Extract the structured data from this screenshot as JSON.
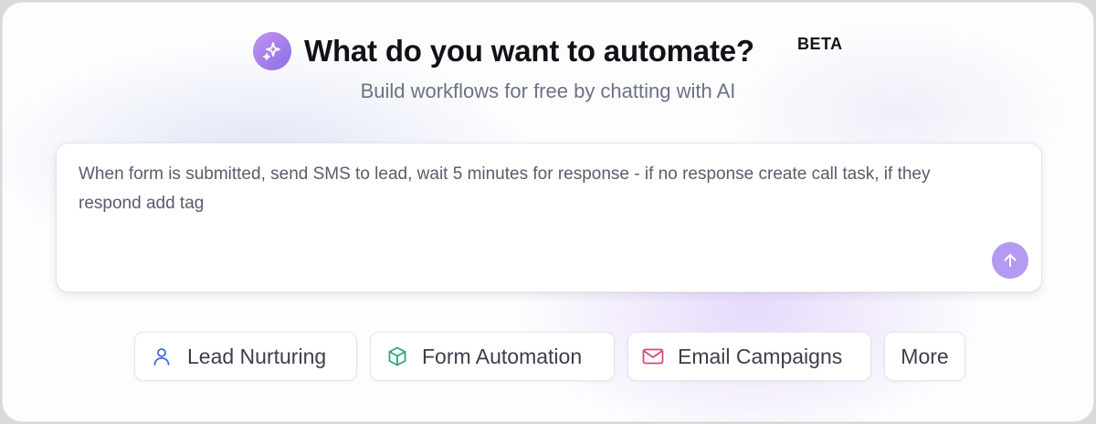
{
  "header": {
    "title": "What do you want to automate?",
    "badge": "BETA",
    "subtitle": "Build workflows for free by chatting with AI",
    "icon": "sparkle-icon"
  },
  "prompt": {
    "value": "When form is submitted, send SMS to lead, wait 5 minutes for response - if no response create call task, if they respond add tag",
    "send_icon": "arrow-up-icon"
  },
  "chips": [
    {
      "label": "Lead Nurturing",
      "icon": "user-icon",
      "icon_color": "#3b6fd8"
    },
    {
      "label": "Form Automation",
      "icon": "cube-icon",
      "icon_color": "#2fa57a"
    },
    {
      "label": "Email Campaigns",
      "icon": "mail-icon",
      "icon_color": "#d9487a"
    },
    {
      "label": "More"
    }
  ],
  "colors": {
    "accent": "#b49af0",
    "badge_gradient_start": "#c493f0",
    "badge_gradient_end": "#8b6de8"
  }
}
